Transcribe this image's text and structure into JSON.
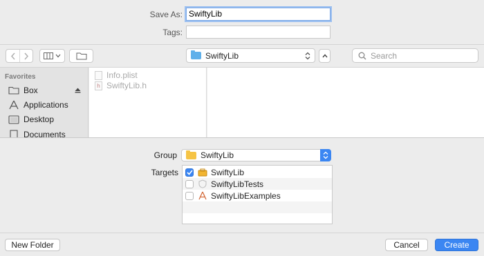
{
  "save_as": {
    "label": "Save As:",
    "value": "SwiftyLib"
  },
  "tags": {
    "label": "Tags:",
    "value": ""
  },
  "toolbar": {
    "location": "SwiftyLib",
    "search_placeholder": "Search"
  },
  "sidebar": {
    "heading": "Favorites",
    "items": [
      {
        "label": "Box"
      },
      {
        "label": "Applications"
      },
      {
        "label": "Desktop"
      },
      {
        "label": "Documents"
      }
    ]
  },
  "files": [
    {
      "name": "Info.plist"
    },
    {
      "name": "SwiftyLib.h"
    }
  ],
  "group": {
    "label": "Group",
    "value": "SwiftyLib"
  },
  "targets": {
    "label": "Targets",
    "items": [
      {
        "name": "SwiftyLib",
        "checked": true
      },
      {
        "name": "SwiftyLibTests",
        "checked": false
      },
      {
        "name": "SwiftyLibExamples",
        "checked": false
      }
    ]
  },
  "buttons": {
    "new_folder": "New Folder",
    "cancel": "Cancel",
    "create": "Create"
  },
  "colors": {
    "accent": "#3b86f2",
    "folder_blue": "#5fb0ea",
    "folder_yellow": "#f6c445"
  }
}
